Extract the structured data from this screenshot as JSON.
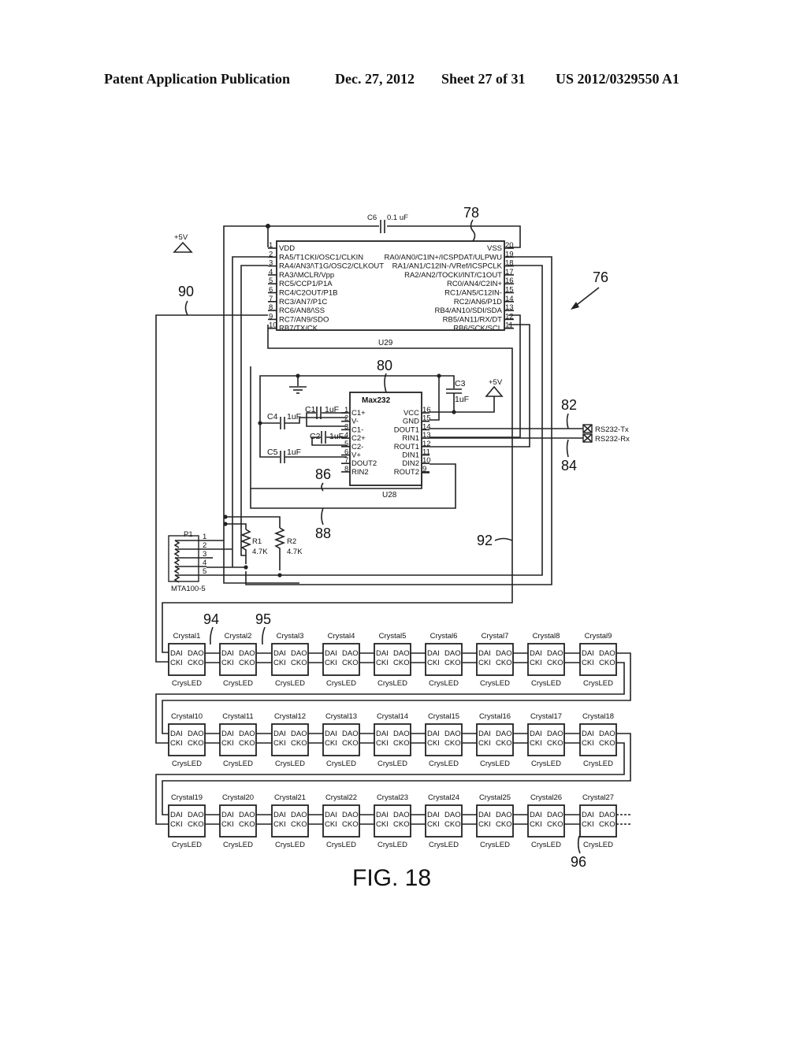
{
  "header": {
    "publication": "Patent Application Publication",
    "date": "Dec. 27, 2012",
    "sheet": "Sheet 27 of 31",
    "number": "US 2012/0329550 A1"
  },
  "figure": {
    "caption": "FIG. 18"
  },
  "refs": {
    "r76": "76",
    "r78": "78",
    "r80": "80",
    "r82": "82",
    "r84": "84",
    "r86": "86",
    "r88": "88",
    "r90": "90",
    "r92": "92",
    "r94": "94",
    "r95": "95",
    "r96": "96"
  },
  "power": {
    "vcc_label": "+5V",
    "ground_label": "GND"
  },
  "mcu": {
    "designator": "U29",
    "decoupling": {
      "name": "C6",
      "value": "0.1 uF"
    },
    "left_pins": [
      {
        "num": "1",
        "name": "VDD"
      },
      {
        "num": "2",
        "name": "RA5/T1CKI/OSC1/CLKIN"
      },
      {
        "num": "3",
        "name": "RA4/AN3/\\T1G/OSC2/CLKOUT"
      },
      {
        "num": "4",
        "name": "RA3/\\MCLR/Vpp"
      },
      {
        "num": "5",
        "name": "RC5/CCP1/P1A"
      },
      {
        "num": "6",
        "name": "RC4/C2OUT/P1B"
      },
      {
        "num": "7",
        "name": "RC3/AN7/P1C"
      },
      {
        "num": "8",
        "name": "RC6/AN8/\\SS"
      },
      {
        "num": "9",
        "name": "RC7/AN9/SDO"
      },
      {
        "num": "10",
        "name": "RB7/TX/CK"
      }
    ],
    "right_pins": [
      {
        "num": "20",
        "name": "VSS"
      },
      {
        "num": "19",
        "name": "RA0/AN0/C1IN+/ICSPDAT/ULPWU"
      },
      {
        "num": "18",
        "name": "RA1/AN1/C12IN-/VRef/ICSPCLK"
      },
      {
        "num": "17",
        "name": "RA2/AN2/TOCKI/INT/C1OUT"
      },
      {
        "num": "16",
        "name": "RC0/AN4/C2IN+"
      },
      {
        "num": "15",
        "name": "RC1/AN5/C12IN-"
      },
      {
        "num": "14",
        "name": "RC2/AN6/P1D"
      },
      {
        "num": "13",
        "name": "RB4/AN10/SDI/SDA"
      },
      {
        "num": "12",
        "name": "RB5/AN11/RX/DT"
      },
      {
        "num": "11",
        "name": "RB6/SCK/SCL"
      }
    ]
  },
  "max232": {
    "title": "Max232",
    "designator": "U28",
    "left_pins": [
      {
        "num": "1",
        "name": "C1+"
      },
      {
        "num": "2",
        "name": "V-"
      },
      {
        "num": "3",
        "name": "C1-"
      },
      {
        "num": "4",
        "name": "C2+"
      },
      {
        "num": "5",
        "name": "C2-"
      },
      {
        "num": "6",
        "name": "V+"
      },
      {
        "num": "7",
        "name": "DOUT2"
      },
      {
        "num": "8",
        "name": "RIN2"
      }
    ],
    "right_pins": [
      {
        "num": "16",
        "name": "VCC"
      },
      {
        "num": "15",
        "name": "GND"
      },
      {
        "num": "14",
        "name": "DOUT1"
      },
      {
        "num": "13",
        "name": "RIN1"
      },
      {
        "num": "12",
        "name": "ROUT1"
      },
      {
        "num": "11",
        "name": "DIN1"
      },
      {
        "num": "10",
        "name": "DIN2"
      },
      {
        "num": "9",
        "name": "ROUT2"
      }
    ],
    "capacitors": [
      {
        "name": "C1",
        "value": "1uF"
      },
      {
        "name": "C2",
        "value": "1uF"
      },
      {
        "name": "C3",
        "value": "1uF"
      },
      {
        "name": "C4",
        "value": "1uF"
      },
      {
        "name": "C5",
        "value": "1uF"
      }
    ]
  },
  "rs232": {
    "tx": "RS232-Tx",
    "rx": "RS232-Rx"
  },
  "connector": {
    "name": "P1",
    "part": "MTA100-5",
    "pins": [
      "1",
      "2",
      "3",
      "4",
      "5"
    ]
  },
  "resistors": [
    {
      "name": "R1",
      "value": "4.7K"
    },
    {
      "name": "R2",
      "value": "4.7K"
    }
  ],
  "led_chain": {
    "part_label": "CrysLED",
    "pins": {
      "dai": "DAI",
      "dao": "DAO",
      "cki": "CKI",
      "cko": "CKO"
    },
    "crystals": [
      "Crystal1",
      "Crystal2",
      "Crystal3",
      "Crystal4",
      "Crystal5",
      "Crystal6",
      "Crystal7",
      "Crystal8",
      "Crystal9",
      "Crystal10",
      "Crystal11",
      "Crystal12",
      "Crystal13",
      "Crystal14",
      "Crystal15",
      "Crystal16",
      "Crystal17",
      "Crystal18",
      "Crystal19",
      "Crystal20",
      "Crystal21",
      "Crystal22",
      "Crystal23",
      "Crystal24",
      "Crystal25",
      "Crystal26",
      "Crystal27"
    ]
  }
}
